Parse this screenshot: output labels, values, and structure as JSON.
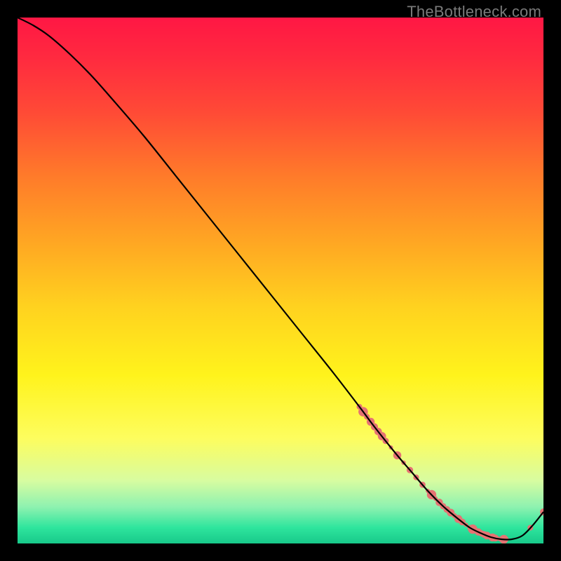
{
  "watermark": "TheBottleneck.com",
  "gradient_stops": [
    {
      "offset": 0.0,
      "color": "#ff1744"
    },
    {
      "offset": 0.08,
      "color": "#ff2b3f"
    },
    {
      "offset": 0.18,
      "color": "#ff4a36"
    },
    {
      "offset": 0.3,
      "color": "#ff7a2a"
    },
    {
      "offset": 0.42,
      "color": "#ffa423"
    },
    {
      "offset": 0.55,
      "color": "#ffd21f"
    },
    {
      "offset": 0.68,
      "color": "#fff31c"
    },
    {
      "offset": 0.8,
      "color": "#fdfd5e"
    },
    {
      "offset": 0.88,
      "color": "#d8fca0"
    },
    {
      "offset": 0.93,
      "color": "#8ff2b0"
    },
    {
      "offset": 0.97,
      "color": "#2ee59d"
    },
    {
      "offset": 1.0,
      "color": "#18c98a"
    }
  ],
  "chart_data": {
    "type": "line",
    "title": "",
    "xlabel": "",
    "ylabel": "",
    "xlim": [
      0,
      100
    ],
    "ylim": [
      0,
      100
    ],
    "x": [
      0,
      3,
      6,
      10,
      14,
      18,
      24,
      30,
      36,
      42,
      48,
      54,
      60,
      65,
      68,
      72,
      75,
      78,
      81,
      84,
      86,
      88,
      90,
      92,
      94,
      96,
      98,
      100
    ],
    "values": [
      100,
      98.5,
      96.5,
      93,
      89,
      84.5,
      77.5,
      70,
      62.5,
      55,
      47.5,
      40,
      32.5,
      26,
      22,
      17,
      13.5,
      10,
      7,
      4.5,
      3,
      2,
      1.2,
      0.8,
      0.8,
      1.5,
      3.5,
      6
    ],
    "marker_clusters": [
      {
        "x_start": 65,
        "x_end": 70,
        "y_start": 26,
        "y_end": 20,
        "count": 8,
        "size_min": 4,
        "size_max": 7
      },
      {
        "x_start": 71,
        "x_end": 77,
        "y_start": 18,
        "y_end": 11,
        "count": 6,
        "size_min": 3,
        "size_max": 6
      },
      {
        "x_start": 78,
        "x_end": 86,
        "y_start": 10,
        "y_end": 3,
        "count": 12,
        "size_min": 3,
        "size_max": 7
      },
      {
        "x_start": 86,
        "x_end": 93,
        "y_start": 3,
        "y_end": 0.8,
        "count": 14,
        "size_min": 3,
        "size_max": 7
      }
    ],
    "loose_markers": [
      {
        "x": 97.5,
        "y": 3.0,
        "r": 4
      },
      {
        "x": 100,
        "y": 6.0,
        "r": 5
      }
    ],
    "marker_color": "#e57373",
    "line_color": "#000000"
  }
}
